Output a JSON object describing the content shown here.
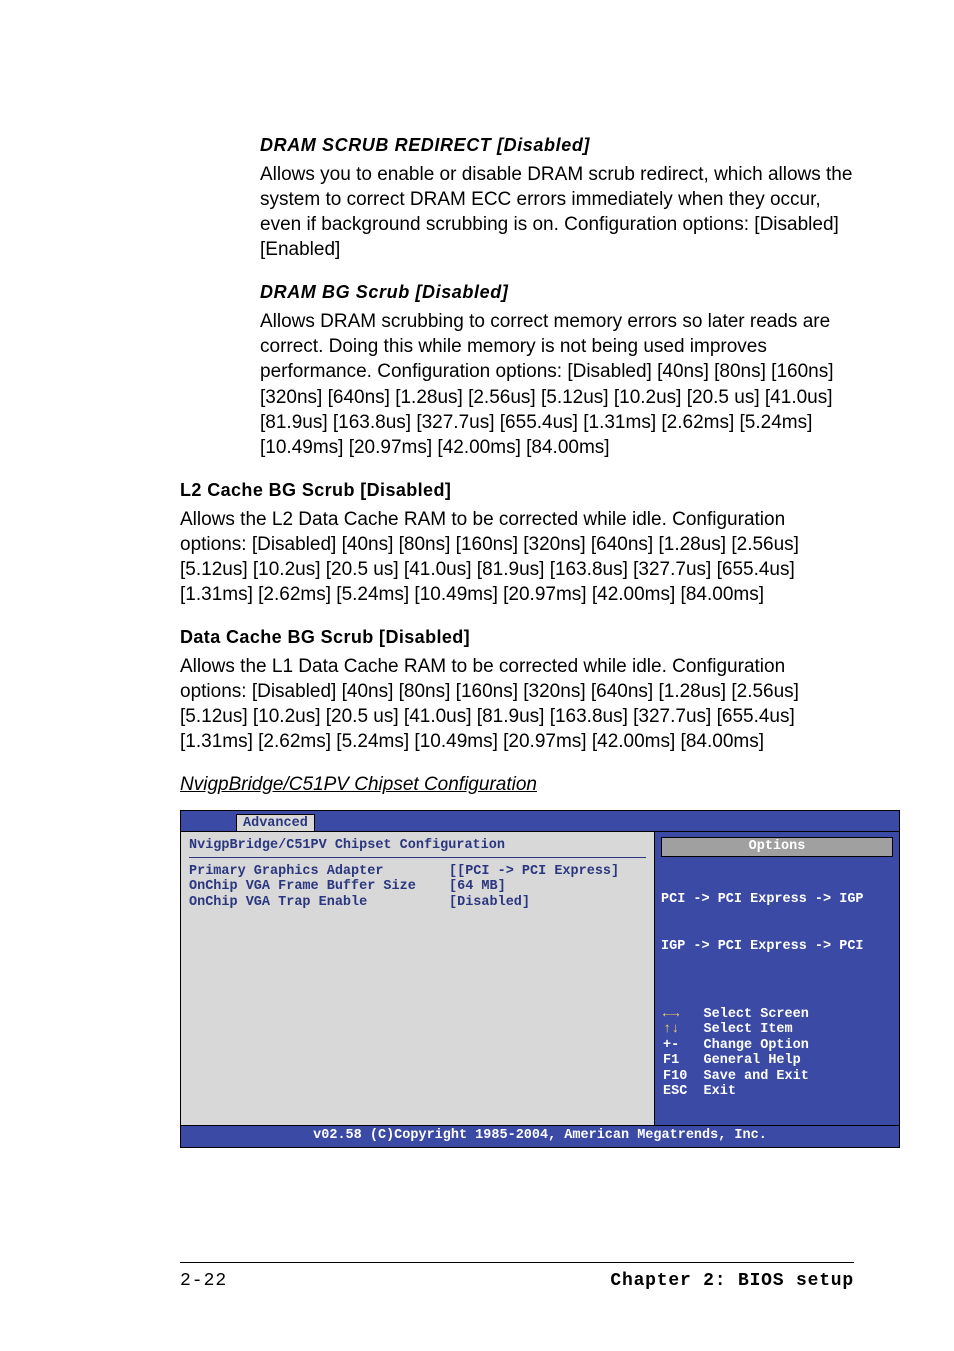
{
  "sections": {
    "dram_scrub_redirect": {
      "title": "DRAM SCRUB REDIRECT [Disabled]",
      "body": "Allows you to enable or disable DRAM scrub redirect, which allows the system to correct DRAM ECC errors immediately when they occur, even if background scrubbing is on. Configuration options: [Disabled] [Enabled]"
    },
    "dram_bg_scrub": {
      "title": "DRAM BG Scrub [Disabled]",
      "body": "Allows DRAM scrubbing to correct memory errors so later reads are correct. Doing this while memory is not being used improves performance. Configuration options: [Disabled] [40ns] [80ns] [160ns] [320ns] [640ns] [1.28us] [2.56us] [5.12us] [10.2us] [20.5 us] [41.0us] [81.9us] [163.8us] [327.7us] [655.4us] [1.31ms] [2.62ms] [5.24ms] [10.49ms] [20.97ms] [42.00ms] [84.00ms]"
    },
    "l2_cache_bg_scrub": {
      "title": "L2 Cache BG Scrub [Disabled]",
      "body": "Allows the L2 Data Cache RAM to be corrected while idle. Configuration options: [Disabled] [40ns] [80ns] [160ns] [320ns] [640ns] [1.28us] [2.56us] [5.12us] [10.2us] [20.5 us] [41.0us] [81.9us] [163.8us] [327.7us] [655.4us] [1.31ms] [2.62ms] [5.24ms] [10.49ms] [20.97ms] [42.00ms] [84.00ms]"
    },
    "data_cache_bg_scrub": {
      "title": "Data Cache BG Scrub [Disabled]",
      "body": "Allows the L1 Data Cache RAM to be corrected while idle. Configuration options: [Disabled] [40ns] [80ns] [160ns] [320ns] [640ns] [1.28us] [2.56us] [5.12us] [10.2us] [20.5 us] [41.0us] [81.9us] [163.8us] [327.7us] [655.4us] [1.31ms] [2.62ms] [5.24ms] [10.49ms] [20.97ms] [42.00ms] [84.00ms]"
    }
  },
  "subheading": "NvigpBridge/C51PV Chipset Configuration",
  "bios": {
    "tab": "Advanced",
    "title": "NvigpBridge/C51PV Chipset Configuration",
    "rows": [
      {
        "label": "Primary Graphics Adapter",
        "value": "[[PCI -> PCI Express]"
      },
      {
        "label": "OnChip VGA Frame Buffer Size",
        "value": "[64 MB]"
      },
      {
        "label": "OnChip VGA Trap Enable",
        "value": "[Disabled]"
      }
    ],
    "sidebar": {
      "title": "Options",
      "lines": [
        "PCI -> PCI Express -> IGP",
        "IGP -> PCI Express -> PCI"
      ]
    },
    "help": [
      {
        "key": "←→",
        "desc": "Select Screen"
      },
      {
        "key": "↑↓",
        "desc": "Select Item"
      },
      {
        "key": "+-",
        "desc": "Change Option"
      },
      {
        "key": "F1",
        "desc": "General Help"
      },
      {
        "key": "F10",
        "desc": "Save and Exit"
      },
      {
        "key": "ESC",
        "desc": "Exit"
      }
    ],
    "footer": "v02.58 (C)Copyright 1985-2004, American Megatrends, Inc."
  },
  "footer": {
    "page": "2-22",
    "chapter": "Chapter 2: BIOS setup"
  }
}
